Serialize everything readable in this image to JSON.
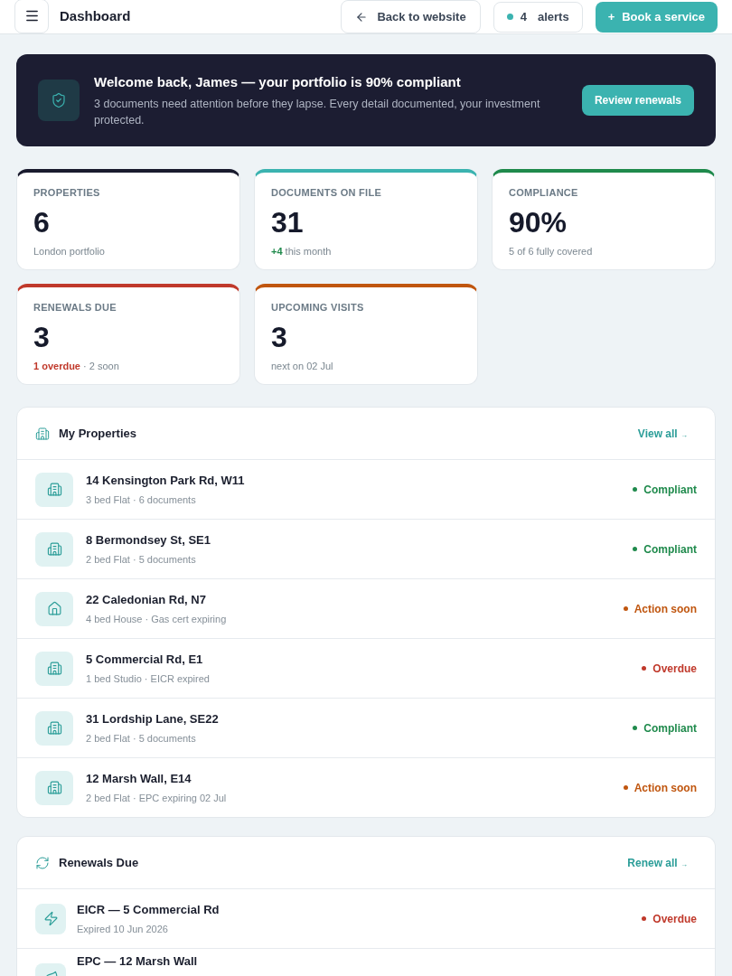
{
  "header": {
    "title": "Dashboard",
    "back_link": "Back to website",
    "alerts": {
      "count": "4",
      "label": "alerts"
    },
    "book_button": {
      "icon": "+",
      "label": "Book a service"
    }
  },
  "banner": {
    "title": "Welcome back, James — your portfolio is 90% compliant",
    "text": "3 documents need attention before they lapse. Every detail documented, your investment protected.",
    "button": "Review renewals"
  },
  "stats": [
    {
      "label": "PROPERTIES",
      "value": "6",
      "note": "London portfolio",
      "color": "#1a1b2e"
    },
    {
      "label": "DOCUMENTS ON FILE",
      "value": "31",
      "highlight": {
        "kind": "positive",
        "text": "+4"
      },
      "note": "this month",
      "color": "#3bb3b0"
    },
    {
      "label": "COMPLIANCE",
      "value": "90%",
      "note": "5 of 6 fully covered",
      "color": "#1f8a4c"
    },
    {
      "label": "RENEWALS DUE",
      "value": "3",
      "highlight": {
        "kind": "negative",
        "text": "1 overdue"
      },
      "note": "· 2 soon",
      "color": "#c0392b"
    },
    {
      "label": "UPCOMING VISITS",
      "value": "3",
      "note": "next on 02 Jul",
      "color": "#c0560f"
    }
  ],
  "properties": {
    "title": "My Properties",
    "link": "View all",
    "link_arrow": "→",
    "items": [
      {
        "kind": "flat",
        "name": "14 Kensington Park Rd, W11",
        "detail": "3 bed Flat · 6 documents",
        "status": "Compliant",
        "color": "#1f8a4c"
      },
      {
        "kind": "flat",
        "name": "8 Bermondsey St, SE1",
        "detail": "2 bed Flat · 5 documents",
        "status": "Compliant",
        "color": "#1f8a4c"
      },
      {
        "kind": "house",
        "name": "22 Caledonian Rd, N7",
        "detail": "4 bed House · Gas cert expiring",
        "status": "Action soon",
        "color": "#c0560f"
      },
      {
        "kind": "flat",
        "name": "5 Commercial Rd, E1",
        "detail": "1 bed Studio · EICR expired",
        "status": "Overdue",
        "color": "#c0392b"
      },
      {
        "kind": "flat",
        "name": "31 Lordship Lane, SE22",
        "detail": "2 bed Flat · 5 documents",
        "status": "Compliant",
        "color": "#1f8a4c"
      },
      {
        "kind": "flat",
        "name": "12 Marsh Wall, E14",
        "detail": "2 bed Flat · EPC expiring 02 Jul",
        "status": "Action soon",
        "color": "#c0560f"
      }
    ]
  },
  "renewals": {
    "title": "Renewals Due",
    "link": "Renew all",
    "link_arrow": "→",
    "items": [
      {
        "kind": "electric",
        "name": "EICR — 5 Commercial Rd",
        "detail": "Expired 10 Jun 2026",
        "status": "Overdue",
        "color": "#c0392b"
      },
      {
        "kind": "energy",
        "name": "EPC — 12 Marsh Wall"
      }
    ]
  }
}
